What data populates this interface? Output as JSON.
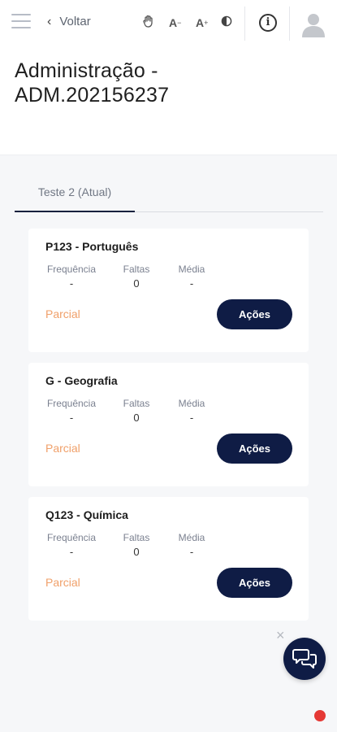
{
  "header": {
    "back_label": "Voltar",
    "font_decrease": "A",
    "font_decrease_sign": "−",
    "font_increase": "A",
    "font_increase_sign": "+",
    "info_icon": "i"
  },
  "page": {
    "title_line1": "Administração -",
    "title_line2": "ADM.202156237"
  },
  "tabs": [
    {
      "label": "Teste 2 (Atual)"
    }
  ],
  "labels": {
    "frequency": "Frequência",
    "absences": "Faltas",
    "average": "Média"
  },
  "subjects": [
    {
      "title": "P123 - Português",
      "frequency": "-",
      "absences": "0",
      "average": "-",
      "status": "Parcial",
      "action_label": "Ações"
    },
    {
      "title": "G - Geografia",
      "frequency": "-",
      "absences": "0",
      "average": "-",
      "status": "Parcial",
      "action_label": "Ações"
    },
    {
      "title": "Q123 - Química",
      "frequency": "-",
      "absences": "0",
      "average": "-",
      "status": "Parcial",
      "action_label": "Ações"
    }
  ],
  "chat": {
    "close_label": "×"
  },
  "colors": {
    "navy": "#0f1c45",
    "status_orange": "#f0a06a",
    "alert_red": "#e53935"
  },
  "icons": [
    "menu-icon",
    "chevron-left-icon",
    "hand-icon",
    "contrast-icon",
    "info-icon",
    "user-avatar-icon",
    "chat-bubbles-icon"
  ]
}
